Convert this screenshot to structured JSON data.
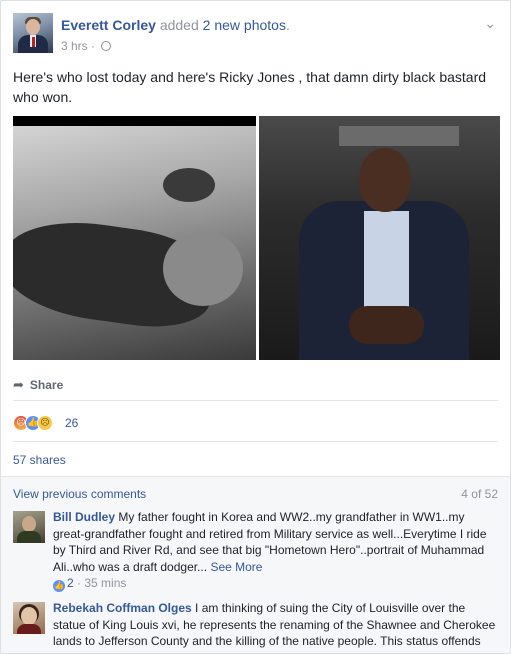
{
  "post": {
    "author": "Everett Corley",
    "action_prefix": "added",
    "action_link": "2 new photos",
    "action_suffix": ".",
    "time": "3 hrs",
    "dot": "·",
    "text": "Here's who lost today and here's Ricky Jones , that damn dirty black bastard who won."
  },
  "actions": {
    "share_label": "Share"
  },
  "reactions": {
    "types": [
      "angry",
      "like",
      "sad"
    ],
    "count": "26"
  },
  "shares_label": "57 shares",
  "comments": {
    "view_previous": "View previous comments",
    "position": "4 of 52",
    "items": [
      {
        "author": "Bill Dudley",
        "text": "My father fought in Korea and WW2..my grandfather in WW1..my great-grandfather fought and retired from Military service as well...Everytime I ride by Third and River Rd, and see that big \"Hometown Hero\"..portrait of Muhammad Ali..who was a draft dodger...",
        "see_more": "See More",
        "likes": "2",
        "time": "35 mins"
      },
      {
        "author": "Rebekah Coffman Olges",
        "text": "I am thinking of suing the City of Louisville over the statue of King Louis xvi, he represents the renaming of the Shawnee and Cherokee lands to Jefferson County and the killing of the native people. This status offends me."
      }
    ]
  },
  "colors": {
    "link_blue": "#365899",
    "meta_gray": "#90949c",
    "text": "#1d2129",
    "like_blue": "#5890ff"
  }
}
